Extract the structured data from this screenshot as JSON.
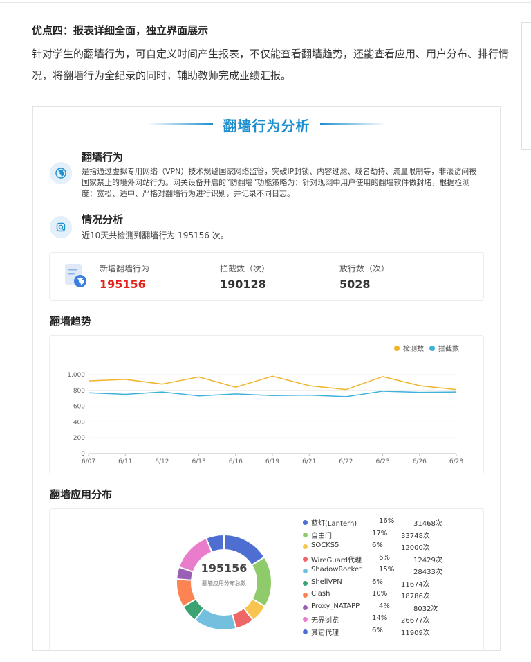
{
  "intro": {
    "title": "优点四：报表详细全面，独立界面展示",
    "text": "针对学生的翻墙行为，可自定义时间产生报表，不仅能查看翻墙趋势，还能查看应用、用户分布、排行情况，将翻墙行为全纪录的同时，辅助教师完成业绩汇报。"
  },
  "report": {
    "banner_title": "翻墙行为分析",
    "section1": {
      "title": "翻墙行为",
      "text": "是指通过虚拟专用网络（VPN）技术规避国家网络监管，突破IP封锁、内容过滤、域名劫持、流量限制等，非法访问被国家禁止的境外网站行为。网关设备开启的“防翻墙”功能策略为：针对现网中用户使用的翻墙软件做封堵，根据检测度：宽松、适中、严格对翻墙行为进行识别，并记录不同日志。"
    },
    "section2": {
      "title": "情况分析",
      "text": "近10天共检测到翻墙行为 195156 次。"
    },
    "stats": [
      {
        "label": "新增翻墙行为",
        "value": "195156"
      },
      {
        "label": "拦截数（次）",
        "value": "190128"
      },
      {
        "label": "放行数（次）",
        "value": "5028"
      }
    ],
    "trend_title": "翻墙趋势",
    "apps_title": "翻墙应用分布",
    "donut_total": "195156",
    "donut_caption": "翻墙应用分布总数"
  },
  "colors": {
    "accent": "#1d8fcf",
    "highlight_red": "#e2231a",
    "detect_series": "#f0b429",
    "block_series": "#3db1d9"
  },
  "chart_data": [
    {
      "type": "line",
      "x": [
        "6/07",
        "6/11",
        "6/12",
        "6/13",
        "6/16",
        "6/19",
        "6/21",
        "6/22",
        "6/23",
        "6/26",
        "6/28"
      ],
      "yticks": [
        "0",
        "200",
        "400",
        "600",
        "800",
        "1,000"
      ],
      "ylim": [
        0,
        1000
      ],
      "grid": true,
      "legend_position": "top-right",
      "series": [
        {
          "name": "检测数",
          "color": "#f0b429",
          "values": [
            920,
            940,
            880,
            970,
            840,
            980,
            860,
            810,
            975,
            860,
            810
          ]
        },
        {
          "name": "拦截数",
          "color": "#3db1d9",
          "values": [
            770,
            750,
            780,
            730,
            755,
            735,
            740,
            720,
            790,
            775,
            780
          ]
        }
      ]
    },
    {
      "type": "pie",
      "categories": [
        "蓝灯(Lantern)",
        "自由门",
        "SOCKS5",
        "WireGuard代理",
        "ShadowRocket",
        "ShellVPN",
        "Clash",
        "Proxy_NATAPP",
        "无界浏览",
        "其它代理"
      ],
      "percents": [
        "16%",
        "17%",
        "6%",
        "6%",
        "15%",
        "6%",
        "10%",
        "4%",
        "14%",
        "6%"
      ],
      "counts": [
        "31468次",
        "33748次",
        "12000次",
        "12429次",
        "28433次",
        "11674次",
        "18786次",
        "8032次",
        "26677次",
        "11909次"
      ],
      "values": [
        31468,
        33748,
        12000,
        12429,
        28433,
        11674,
        18786,
        8032,
        26677,
        11909
      ],
      "colors": [
        "#4e6fd1",
        "#8fcb6b",
        "#f7c450",
        "#ee6666",
        "#73c0de",
        "#3ba272",
        "#fc8452",
        "#9a60b4",
        "#ea7ccc",
        "#4e6fd1"
      ]
    }
  ]
}
